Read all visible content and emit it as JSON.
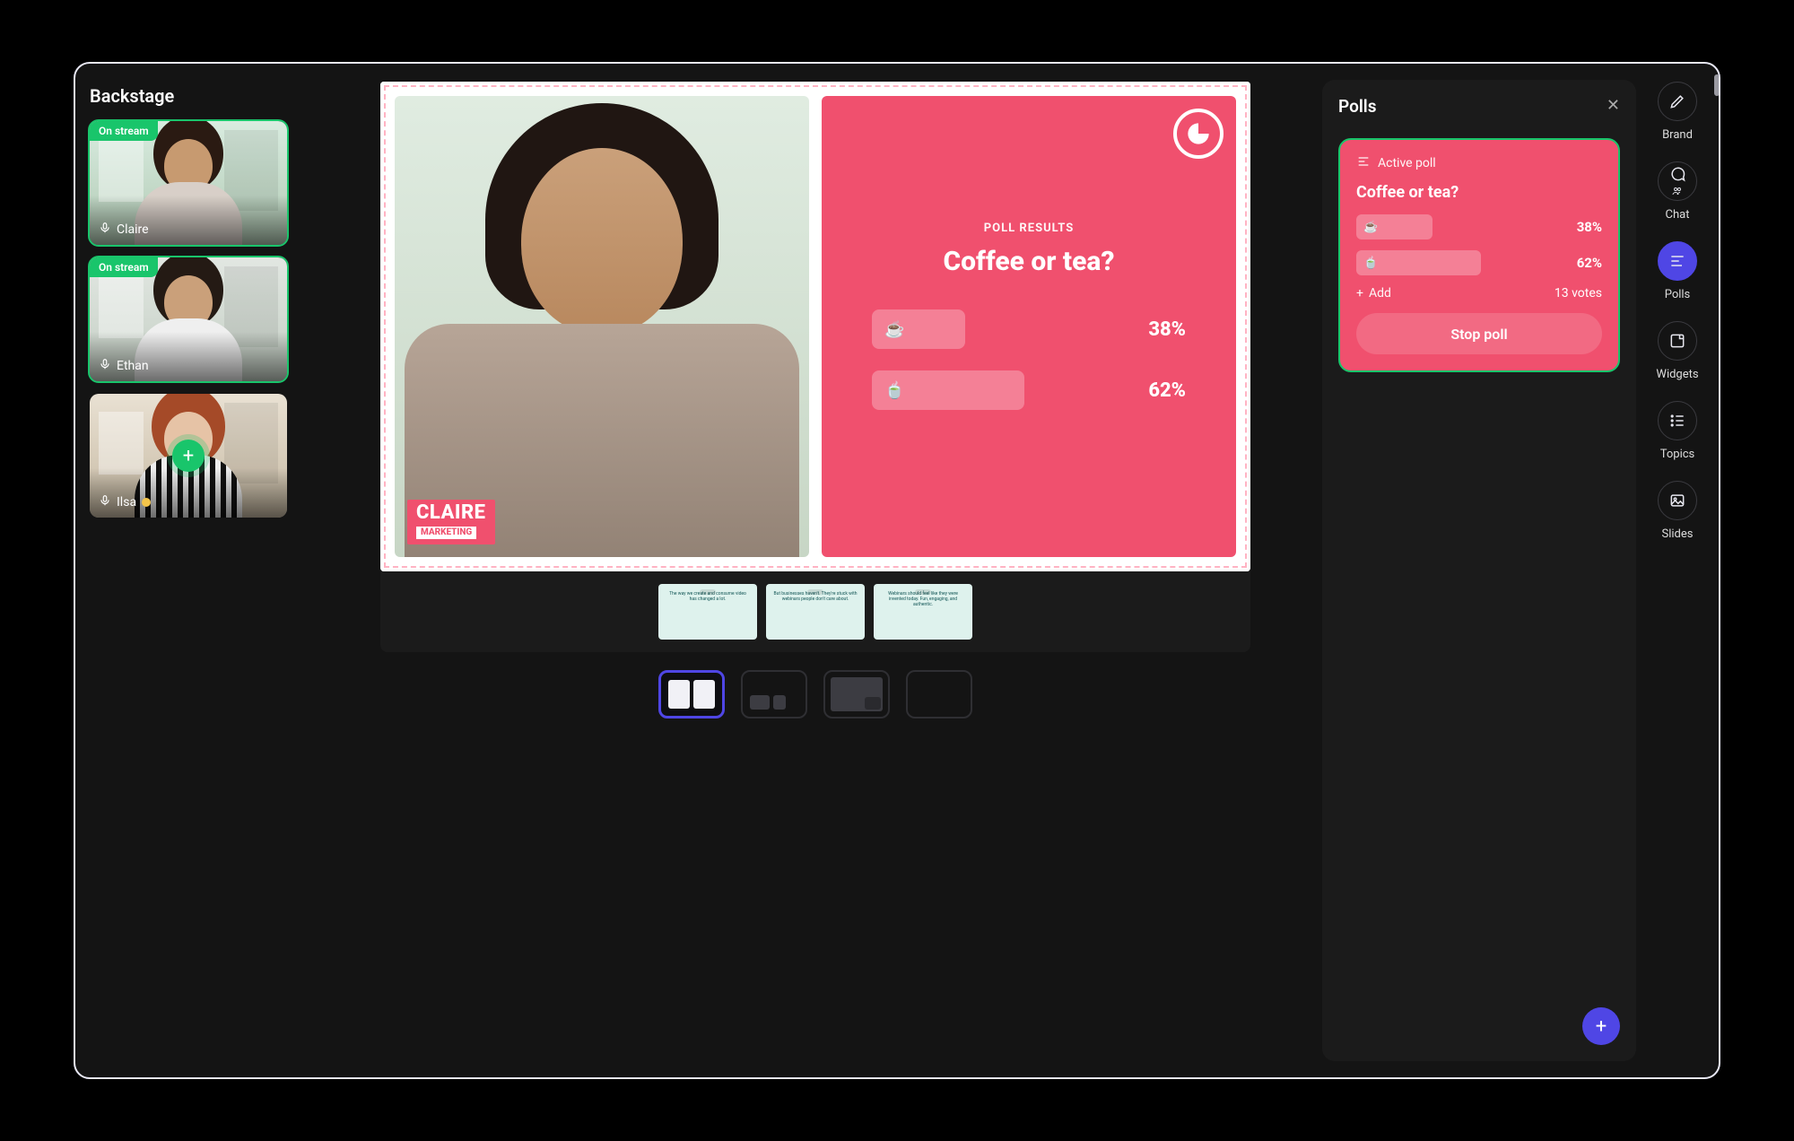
{
  "backstage": {
    "title": "Backstage",
    "onstream_label": "On stream",
    "participants": [
      {
        "name": "Claire",
        "onstream": true,
        "skin": "#c79a70",
        "hair": "#2a1a12",
        "shirt": "#d8cfc8",
        "room1": "#d9ece0",
        "room2": "#b0c9b3",
        "status": null
      },
      {
        "name": "Ethan",
        "onstream": true,
        "skin": "#caa07a",
        "hair": "#241a14",
        "shirt": "#efefef",
        "room1": "#e2e7e2",
        "room2": "#c3cec3",
        "status": null
      },
      {
        "name": "Ilsa",
        "onstream": false,
        "skin": "#e6c3a6",
        "hair": "#a54a28",
        "shirt": "#1a1a1a",
        "room1": "#e9e1d3",
        "room2": "#c6b9a2",
        "status": "#f3c44a"
      }
    ]
  },
  "stage": {
    "lower_third_name": "CLAIRE",
    "lower_third_role": "MARKETING",
    "poll": {
      "results_label": "POLL RESULTS",
      "question": "Coffee or tea?",
      "options": [
        {
          "emoji": "☕",
          "pct": 38,
          "label": "38%"
        },
        {
          "emoji": "🍵",
          "pct": 62,
          "label": "62%"
        }
      ]
    },
    "slides": [
      "The way we create and consume video has changed a lot.",
      "But businesses haven't. They're stuck with webinars people don't care about.",
      "Webinars should feel like they were invented today. Fun, engaging, and authentic."
    ]
  },
  "polls_panel": {
    "title": "Polls",
    "active_label": "Active poll",
    "question": "Coffee or tea?",
    "options": [
      {
        "emoji": "☕",
        "pct": 38,
        "label": "38%"
      },
      {
        "emoji": "🍵",
        "pct": 62,
        "label": "62%"
      }
    ],
    "add_label": "Add",
    "votes_label": "13 votes",
    "stop_label": "Stop poll"
  },
  "rail": {
    "items": [
      {
        "id": "brand",
        "label": "Brand"
      },
      {
        "id": "chat",
        "label": "Chat"
      },
      {
        "id": "polls",
        "label": "Polls",
        "active": true
      },
      {
        "id": "widgets",
        "label": "Widgets"
      },
      {
        "id": "topics",
        "label": "Topics"
      },
      {
        "id": "slides",
        "label": "Slides"
      }
    ]
  },
  "colors": {
    "accent": "#4f46e5",
    "green": "#19c56b",
    "coral": "#f0506e"
  }
}
